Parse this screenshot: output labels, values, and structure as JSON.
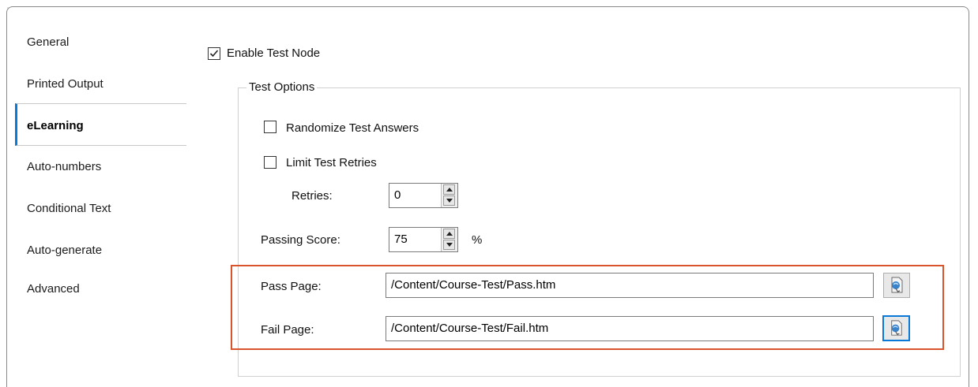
{
  "tabs": [
    "General",
    "Printed Output",
    "eLearning",
    "Auto-numbers",
    "Conditional Text",
    "Auto-generate",
    "Advanced"
  ],
  "active_tab": "eLearning",
  "enable_test_node": {
    "label": "Enable Test Node",
    "checked": true
  },
  "test_options": {
    "title": "Test Options",
    "randomize": {
      "label": "Randomize Test Answers",
      "checked": false
    },
    "limit_retries": {
      "label": "Limit Test Retries",
      "checked": false
    },
    "retries": {
      "label": "Retries:",
      "value": "0"
    },
    "passing_score": {
      "label": "Passing Score:",
      "value": "75",
      "unit": "%"
    },
    "pass_page": {
      "label": "Pass Page:",
      "value": "/Content/Course-Test/Pass.htm"
    },
    "fail_page": {
      "label": "Fail Page:",
      "value": "/Content/Course-Test/Fail.htm"
    }
  },
  "colors": {
    "highlight_box": "#d9532c",
    "focus_ring": "#0a78d7",
    "tab_bg": "#e2e2e2"
  }
}
